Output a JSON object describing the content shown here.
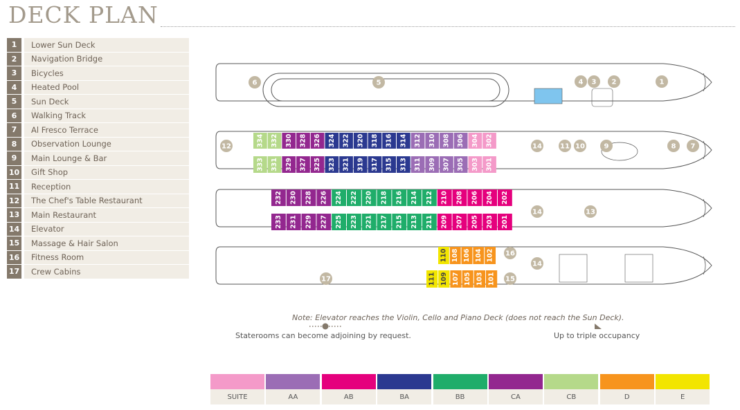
{
  "title": "DECK PLAN",
  "legend": [
    {
      "num": "1",
      "label": "Lower Sun Deck"
    },
    {
      "num": "2",
      "label": "Navigation Bridge"
    },
    {
      "num": "3",
      "label": "Bicycles"
    },
    {
      "num": "4",
      "label": "Heated Pool"
    },
    {
      "num": "5",
      "label": "Sun Deck"
    },
    {
      "num": "6",
      "label": "Walking Track"
    },
    {
      "num": "7",
      "label": "Al Fresco Terrace"
    },
    {
      "num": "8",
      "label": "Observation Lounge"
    },
    {
      "num": "9",
      "label": "Main Lounge & Bar"
    },
    {
      "num": "10",
      "label": "Gift Shop"
    },
    {
      "num": "11",
      "label": "Reception"
    },
    {
      "num": "12",
      "label": "The Chef's Table Restaurant"
    },
    {
      "num": "13",
      "label": "Main Restaurant"
    },
    {
      "num": "14",
      "label": "Elevator"
    },
    {
      "num": "15",
      "label": "Massage & Hair Salon"
    },
    {
      "num": "16",
      "label": "Fitness Room"
    },
    {
      "num": "17",
      "label": "Crew Cabins"
    }
  ],
  "colors": {
    "SUITE": "#f49ac9",
    "AA": "#9b6db5",
    "AB": "#e5007d",
    "BA": "#2b3990",
    "BB": "#1fad6a",
    "CA": "#93278f",
    "CB": "#b5d98a",
    "D": "#f7941d",
    "E": "#f2e500",
    "marker": "#c2b8a3",
    "hull": "#555555",
    "beige": "#f1ede5",
    "brown": "#84796b"
  },
  "categories": [
    {
      "key": "SUITE",
      "label": "SUITE"
    },
    {
      "key": "AA",
      "label": "AA"
    },
    {
      "key": "AB",
      "label": "AB"
    },
    {
      "key": "BA",
      "label": "BA"
    },
    {
      "key": "BB",
      "label": "BB"
    },
    {
      "key": "CA",
      "label": "CA"
    },
    {
      "key": "CB",
      "label": "CB"
    },
    {
      "key": "D",
      "label": "D"
    },
    {
      "key": "E",
      "label": "E"
    }
  ],
  "decks": [
    {
      "markers": [
        "6",
        "5",
        "4",
        "3",
        "2",
        "1"
      ],
      "cabins_top": [],
      "cabins_bottom": []
    },
    {
      "markers": [
        "12",
        "14",
        "11",
        "10",
        "9",
        "8",
        "7"
      ],
      "cabins_top": [
        {
          "n": "334",
          "c": "CB"
        },
        {
          "n": "332",
          "c": "CB"
        },
        {
          "n": "330",
          "c": "CA"
        },
        {
          "n": "328",
          "c": "CA"
        },
        {
          "n": "326",
          "c": "CA"
        },
        {
          "n": "324",
          "c": "BA"
        },
        {
          "n": "322",
          "c": "BA"
        },
        {
          "n": "320",
          "c": "BA"
        },
        {
          "n": "318",
          "c": "BA"
        },
        {
          "n": "316",
          "c": "BA"
        },
        {
          "n": "314",
          "c": "BA"
        },
        {
          "n": "312",
          "c": "AA"
        },
        {
          "n": "310",
          "c": "AA"
        },
        {
          "n": "308",
          "c": "AA"
        },
        {
          "n": "306",
          "c": "AA"
        },
        {
          "n": "304",
          "c": "SUITE"
        },
        {
          "n": "302",
          "c": "SUITE"
        }
      ],
      "cabins_bottom": [
        {
          "n": "333",
          "c": "CB"
        },
        {
          "n": "331",
          "c": "CB"
        },
        {
          "n": "329",
          "c": "CA"
        },
        {
          "n": "327",
          "c": "CA"
        },
        {
          "n": "325",
          "c": "CA"
        },
        {
          "n": "323",
          "c": "BA"
        },
        {
          "n": "321",
          "c": "BA"
        },
        {
          "n": "319",
          "c": "BA"
        },
        {
          "n": "317",
          "c": "BA"
        },
        {
          "n": "315",
          "c": "BA"
        },
        {
          "n": "313",
          "c": "BA"
        },
        {
          "n": "311",
          "c": "AA"
        },
        {
          "n": "309",
          "c": "AA"
        },
        {
          "n": "307",
          "c": "AA"
        },
        {
          "n": "305",
          "c": "AA"
        },
        {
          "n": "303",
          "c": "SUITE"
        },
        {
          "n": "301",
          "c": "SUITE"
        }
      ]
    },
    {
      "markers": [
        "14",
        "13"
      ],
      "cabins_top": [
        {
          "n": "232",
          "c": "CA"
        },
        {
          "n": "230",
          "c": "CA"
        },
        {
          "n": "228",
          "c": "CA"
        },
        {
          "n": "226",
          "c": "CA"
        },
        {
          "n": "224",
          "c": "BB"
        },
        {
          "n": "222",
          "c": "BB"
        },
        {
          "n": "220",
          "c": "BB"
        },
        {
          "n": "218",
          "c": "BB"
        },
        {
          "n": "216",
          "c": "BB"
        },
        {
          "n": "214",
          "c": "BB"
        },
        {
          "n": "212",
          "c": "BB"
        },
        {
          "n": "210",
          "c": "AB"
        },
        {
          "n": "208",
          "c": "AB"
        },
        {
          "n": "206",
          "c": "AB"
        },
        {
          "n": "204",
          "c": "AB"
        },
        {
          "n": "202",
          "c": "AB"
        }
      ],
      "cabins_bottom": [
        {
          "n": "233",
          "c": "CA"
        },
        {
          "n": "231",
          "c": "CA"
        },
        {
          "n": "229",
          "c": "CA"
        },
        {
          "n": "227",
          "c": "CA"
        },
        {
          "n": "225",
          "c": "BB"
        },
        {
          "n": "223",
          "c": "BB"
        },
        {
          "n": "221",
          "c": "BB"
        },
        {
          "n": "217",
          "c": "BB"
        },
        {
          "n": "215",
          "c": "BB"
        },
        {
          "n": "213",
          "c": "BB"
        },
        {
          "n": "211",
          "c": "BB"
        },
        {
          "n": "209",
          "c": "AB"
        },
        {
          "n": "207",
          "c": "AB"
        },
        {
          "n": "205",
          "c": "AB"
        },
        {
          "n": "203",
          "c": "AB"
        },
        {
          "n": "201",
          "c": "AB"
        }
      ]
    },
    {
      "markers": [
        "16",
        "14",
        "15",
        "17"
      ],
      "cabins_top": [
        {
          "n": "110",
          "c": "E"
        },
        {
          "n": "108",
          "c": "D"
        },
        {
          "n": "106",
          "c": "D"
        },
        {
          "n": "104",
          "c": "D"
        },
        {
          "n": "102",
          "c": "D"
        }
      ],
      "cabins_bottom": [
        {
          "n": "111",
          "c": "E"
        },
        {
          "n": "109",
          "c": "E"
        },
        {
          "n": "107",
          "c": "D"
        },
        {
          "n": "105",
          "c": "D"
        },
        {
          "n": "103",
          "c": "D"
        },
        {
          "n": "101",
          "c": "D"
        }
      ]
    }
  ],
  "note": "Note: Elevator reaches the Violin, Cello and Piano Deck (does not reach the Sun Deck).",
  "adjoining_label": "Staterooms can become adjoining by request.",
  "triple_label": "Up to triple occupancy"
}
